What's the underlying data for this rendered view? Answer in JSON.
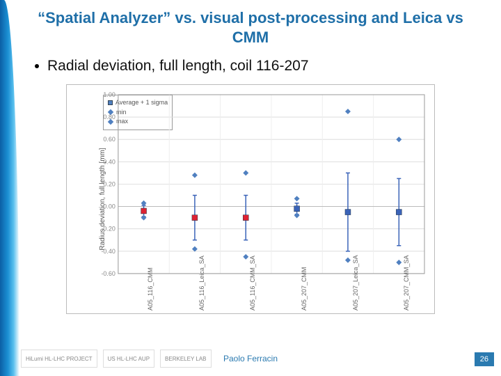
{
  "title": "“Spatial Analyzer” vs. visual post-processing and Leica vs CMM",
  "bullet": "Radial deviation, full length, coil 116-207",
  "ylabel": "Radius deviation, full length [mm]",
  "legend": {
    "avg": "Average + 1 sigma",
    "min": "min",
    "max": "max"
  },
  "author": "Paolo Ferracin",
  "page": "26",
  "logos": [
    "HiLumi HL-LHC PROJECT",
    "US HL-LHC AUP",
    "BERKELEY LAB"
  ],
  "chart_data": {
    "type": "scatter",
    "ylabel": "Radius deviation, full length [mm]",
    "ylim": [
      -0.6,
      1.0
    ],
    "yticks": [
      -0.6,
      -0.4,
      -0.2,
      0.0,
      0.2,
      0.4,
      0.6,
      0.8,
      1.0
    ],
    "categories": [
      "A05_116_CMM",
      "A05_116_Leica_SA",
      "A05_116_CMM_SA",
      "A05_207_CMM",
      "A05_207_Leica_SA",
      "A05_207_CMM_SA"
    ],
    "series": [
      {
        "name": "Average + 1 sigma",
        "kind": "avg_err",
        "color": "#3a63b8",
        "values": [
          {
            "avg": -0.04,
            "err": 0.05,
            "mark": "red"
          },
          {
            "avg": -0.1,
            "err": 0.2,
            "mark": "red"
          },
          {
            "avg": -0.1,
            "err": 0.2,
            "mark": "red"
          },
          {
            "avg": -0.02,
            "err": 0.05,
            "mark": "blue"
          },
          {
            "avg": -0.05,
            "err": 0.35,
            "mark": "blue"
          },
          {
            "avg": -0.05,
            "err": 0.3,
            "mark": "blue"
          }
        ]
      },
      {
        "name": "min",
        "kind": "point",
        "color": "#4d7bc0",
        "values": [
          -0.1,
          -0.38,
          -0.45,
          -0.08,
          -0.48,
          -0.5
        ]
      },
      {
        "name": "max",
        "kind": "point",
        "color": "#4d7bc0",
        "values": [
          0.03,
          0.28,
          0.3,
          0.07,
          0.85,
          0.6
        ]
      }
    ]
  }
}
